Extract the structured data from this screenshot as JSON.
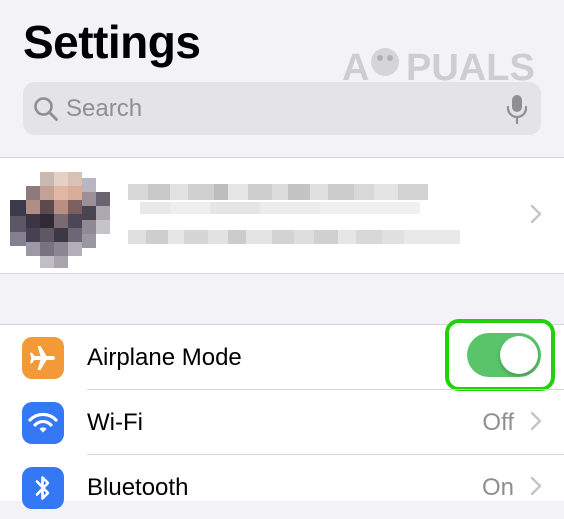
{
  "header": {
    "title": "Settings",
    "watermark_text": "A PUALS"
  },
  "search": {
    "placeholder": "Search",
    "search_icon": "magnifying-glass",
    "mic_icon": "microphone"
  },
  "profile": {
    "avatar": "pixelated-photo",
    "name": "",
    "subtitle": "",
    "chevron_icon": "chevron-right"
  },
  "settings": {
    "rows": [
      {
        "label": "Airplane Mode",
        "icon": "airplane-icon",
        "icon_color": "#f19a37",
        "toggle": true,
        "toggle_on": true,
        "highlight_color": "#22d10c"
      },
      {
        "label": "Wi-Fi",
        "icon": "wifi-icon",
        "icon_color": "#3478f6",
        "value": "Off"
      },
      {
        "label": "Bluetooth",
        "icon": "bluetooth-icon",
        "icon_color": "#3478f6",
        "value": "On"
      }
    ]
  },
  "colors": {
    "background": "#f2f2f7",
    "toggle_on": "#5ac46b",
    "secondary_text": "#8e8e93"
  }
}
